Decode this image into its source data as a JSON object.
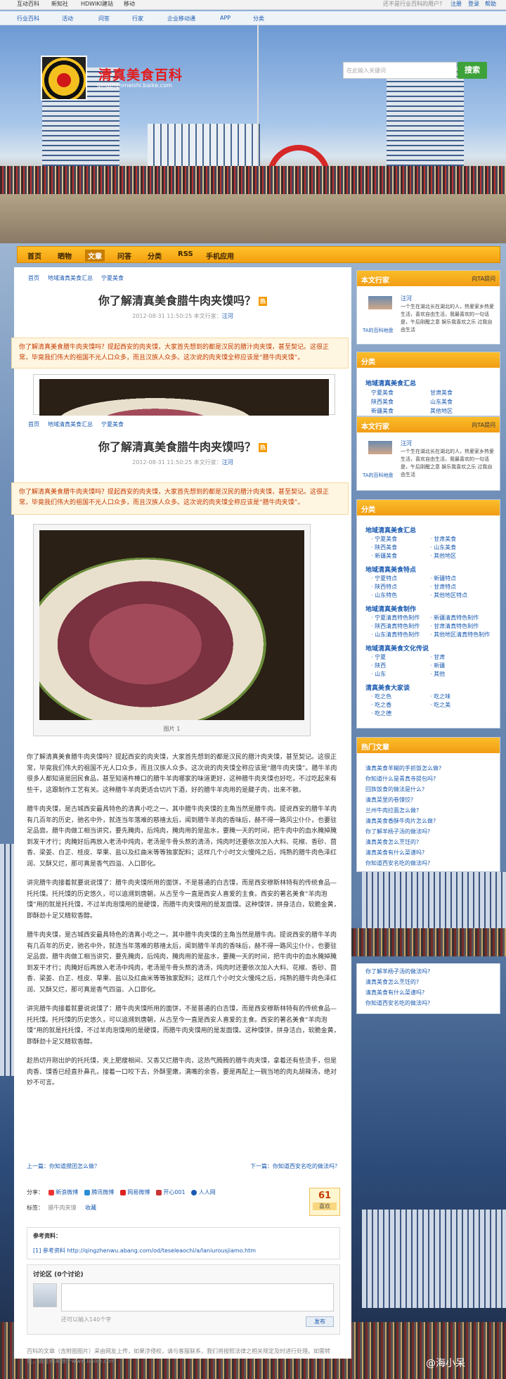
{
  "topbar": {
    "links": [
      "互动百科",
      "新知社",
      "HDWIKI建站",
      "移动"
    ],
    "right_text": "还不是行业百科的用户?",
    "register": "注册",
    "login": "登录",
    "help": "帮助"
  },
  "nav2": [
    "行业百科",
    "活动",
    "问答",
    "行家",
    "企业移动通",
    "APP",
    "分类"
  ],
  "site": {
    "title": "清真美食百科",
    "url": "qingzhenmeishi.baike.com"
  },
  "search": {
    "placeholder": "在此输入关键词",
    "button": "搜索"
  },
  "menu": [
    "首页",
    "晒物",
    "文章",
    "问答",
    "分类",
    "RSS",
    "手机应用"
  ],
  "crumbs": [
    "首页",
    "地域清真美食汇总",
    "宁夏美食"
  ],
  "article": {
    "title": "你了解清真美食腊牛肉夹馍吗？",
    "hot": "热",
    "meta_date": "2012-08-31 11:50:25",
    "meta_author_label": "本文行家：",
    "meta_author": "汪河",
    "summary": "你了解清真美食腊牛肉夹馍吗？提起西安的肉夹馍，大家首先想到的都是汉民的腊汁肉夹馍，甚至契记。这很正常，毕竟我们伟大的祖国不光人口众多，而且汉族人众多。这次说的肉夹馍全称应该是“腊牛肉夹馍”。",
    "image_caption": "图片 1",
    "paragraphs": [
      "你了解清真美食腊牛肉夹馍吗？提起西安的肉夹馍，大家首先想到的都是汉民的腊汁肉夹馍，甚至契记。这很正常，毕竟我们伟大的祖国不光人口众多，而且汉族人众多。这次说的肉夹馍全称应该是“腊牛肉夹馍”。腊牛羊肉很多人都知道是回民食品，甚至知道杵棒口的腊牛羊肉哪家的味道更好，这种腊牛肉夹馍也好吃，不过吃起来有些干，这跟制作工艺有关。这种腊牛羊肉更适合切片下酒，好的腊牛羊肉用的是腱子肉，出来不散。",
      "腊牛肉夹馍，是古城西安最具特色的清真小吃之一。其中腊牛肉夹馍的主角当然是腊牛肉。提说西安的腊牛羊肉有几百年的历史，驰名中外，就连当年落难的慈禧太后，闻到腊牛羊肉的香味后，赫不得一路风尘仆仆，也要驻足品尝。腊牛肉做工相当讲究，要先腌肉，后炖肉，腌肉用的是盐水，要腌一天的时间，把牛肉中的血水腌掉腌到发干才行；肉腌好后再放入老汤中炖肉，老汤是牛骨头熬的清汤，炖肉时还要依次加入大料、花椒、香砂、茴香、梁姜、白芷、桂皮、草果、盐以及红曲米等等独家配料；这样几个小时文火慢炖之后，炖熟的腊牛肉色泽红润、又酥又烂，那可真是香气四溢、入口即化。",
      "讲完腊牛肉接着就要说说馍了：腊牛肉夹馍所用的面饼，不是普通的白吉馍，而是西安穆斯林特有的传统食品—托托馍。托托馍的历史悠久，可以追溯到唐朝，从古至今一直是西安人喜爱的主食。西安的著名美食“羊肉泡馍”用的就是托托馍，不过羊肉泡馍用的是硬馍，而腊牛肉夹馍用的是发面馍。这种馍饼，拼身洁白，软脆金黄，即酥劲十足又精软香醇。",
      "腊牛肉夹馍，是古城西安最具特色的清真小吃之一。其中腊牛肉夹馍的主角当然是腊牛肉。提说西安的腊牛羊肉有几百年的历史，驰名中外，就连当年落难的慈禧太后，闻到腊牛羊肉的香味后，赫不得一路风尘仆仆，也要驻足品尝。腊牛肉做工相当讲究，要先腌肉，后炖肉，腌肉用的是盐水，要腌一天的时间，把牛肉中的血水腌掉腌到发干才行；肉腌好后再放入老汤中炖肉，老汤是牛骨头熬的清汤，炖肉时还要依次加入大料、花椒、香砂、茴香、梁姜、白芷、桂皮、草果、盐以及红曲米等等独家配料；这样几个小时文火慢炖之后，炖熟的腊牛肉色泽红润、又酥又烂，那可真是香气四溢、入口即化。",
      "讲完腊牛肉接着就要说说馍了：腊牛肉夹馍所用的面饼，不是普通的白吉馍，而是西安穆斯林特有的传统食品—托托馍。托托馍的历史悠久，可以追溯到唐朝，从古至今一直是西安人喜爱的主食。西安的著名美食“羊肉泡馍”用的就是托托馍，不过羊肉泡馍用的是硬馍，而腊牛肉夹馍用的是发面馍。这种馍饼，拼身洁白，软脆金黄，即酥劲十足又精软香醇。",
      "趁热切开刚出炉的托托馍，夹上肥瘦相间、又香又烂腊牛肉，这热气腾腾的腊牛肉夹馍，拿着还有些烫手，但是肉香、馍香已经直扑鼻孔，接着一口咬下去，外酥里嫩，满嘴的余香，要是再配上一碗当地的肉丸胡辣汤，绝对妙不可言。"
    ],
    "prev": "上一篇：你知道搅团怎么做？",
    "next": "下一篇：你知道西安名吃的做法吗？",
    "share_label": "分享：",
    "share_items": [
      "新浪微博",
      "腾讯微博",
      "网易微博",
      "开心001",
      "人人网"
    ],
    "tags_label": "标签：",
    "tags": [
      "腊牛肉夹馍",
      "收藏"
    ],
    "like_count": "61",
    "like_label": "喜欢",
    "refs_title": "参考资料：",
    "refs_item": "[1] 参考资料 http://qingzhenwu.abang.com/od/teseleaochi/a/laniurousjiamo.htm",
    "comments_title": "讨论区 (0个讨论)",
    "comments_hint": "还可以输入140个字",
    "comments_button": "发布",
    "footer": "百科的文章（含附图图片）采由网友上传，如果涉侵权，请与客服联系，我们将按照法律之相关规定及时进行处理。如需转载，请注明来源于www.baike.com"
  },
  "sidebar": {
    "expert_title": "本文行家",
    "expert_more": "向TA提问",
    "expert_name": "汪河",
    "expert_caption": "TA的百科地盘",
    "expert_desc": "一个生在湖北长在湖北的人，热爱家乡热爱生活，喜欢自由生活，我最喜欢的一句话是，午后刚醒之意 娱乐我喜欢之乐 过我自由生活",
    "cat_title": "分类",
    "cat_groups": [
      {
        "name": "地域清真美食汇总",
        "items": [
          "宁夏美食",
          "甘肃美食",
          "陕西美食",
          "山东美食",
          "新疆美食",
          "其他地区"
        ]
      },
      {
        "name": "地域清真美食特点",
        "items": [
          "宁夏特点",
          "新疆特点",
          "陕西特点",
          "甘肃特点",
          "山东特色",
          "其他地区特点"
        ]
      },
      {
        "name": "地域清真美食制作",
        "items": [
          "宁夏清真特色制作",
          "新疆清真特色制作",
          "陕西清真特色制作",
          "甘肃清真特色制作",
          "山东清真特色制作",
          "其他地区清真特色制作"
        ]
      },
      {
        "name": "地域清真美食文化传说",
        "items": [
          "宁夏",
          "甘肃",
          "陕西",
          "新疆",
          "山东",
          "其他"
        ]
      },
      {
        "name": "清真美食大家谈",
        "items": [
          "吃之色",
          "吃之味",
          "吃之香",
          "吃之美",
          "吃之德"
        ]
      }
    ],
    "hot_title": "热门文章",
    "hot_items": [
      "清真美食羊糊的手抓饭怎么做?",
      "你知道什么是青真寺提包吗?",
      "回族饭食的做法是什么?",
      "清真菜里的卷馍饺?",
      "兰州牛肉拉面怎么做?",
      "清真美食香酥牛肉片怎么做?",
      "你了解羊杨子汤的做法吗?",
      "清真美食怎么烹饪的?",
      "清真美食有什么菜谱吗?",
      "你知道西安名吃的做法吗?"
    ]
  },
  "watermark": "@海小呆"
}
